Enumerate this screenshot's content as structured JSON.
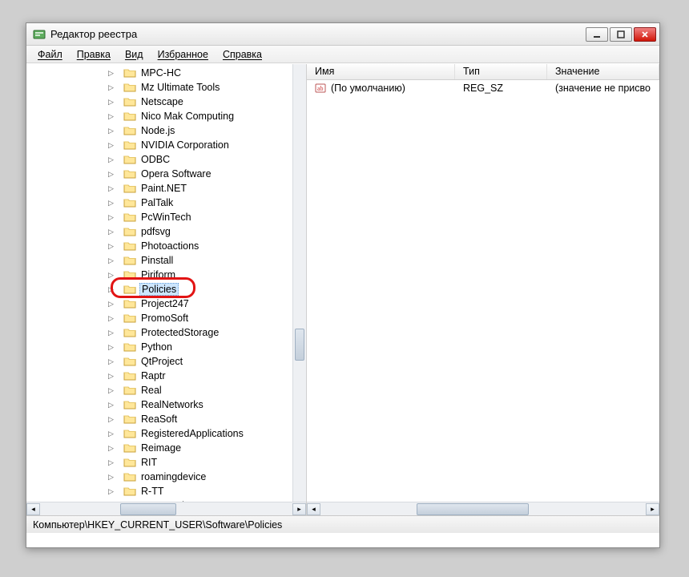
{
  "window": {
    "title": "Редактор реестра"
  },
  "menu": {
    "file": "Файл",
    "edit": "Правка",
    "view": "Вид",
    "favorites": "Избранное",
    "help": "Справка"
  },
  "tree": {
    "items": [
      {
        "label": "MPC-HC",
        "exp": true
      },
      {
        "label": "Mz Ultimate Tools",
        "exp": true
      },
      {
        "label": "Netscape",
        "exp": true
      },
      {
        "label": "Nico Mak Computing",
        "exp": true
      },
      {
        "label": "Node.js",
        "exp": true
      },
      {
        "label": "NVIDIA Corporation",
        "exp": true
      },
      {
        "label": "ODBC",
        "exp": true
      },
      {
        "label": "Opera Software",
        "exp": true
      },
      {
        "label": "Paint.NET",
        "exp": true
      },
      {
        "label": "PalTalk",
        "exp": true
      },
      {
        "label": "PcWinTech",
        "exp": true
      },
      {
        "label": "pdfsvg",
        "exp": true
      },
      {
        "label": "Photoactions",
        "exp": true
      },
      {
        "label": "Pinstall",
        "exp": true
      },
      {
        "label": "Piriform",
        "exp": true
      },
      {
        "label": "Policies",
        "exp": true,
        "selected": true,
        "highlight": true
      },
      {
        "label": "Project247",
        "exp": true
      },
      {
        "label": "PromoSoft",
        "exp": true
      },
      {
        "label": "ProtectedStorage",
        "exp": true
      },
      {
        "label": "Python",
        "exp": true
      },
      {
        "label": "QtProject",
        "exp": true
      },
      {
        "label": "Raptr",
        "exp": true
      },
      {
        "label": "Real",
        "exp": true
      },
      {
        "label": "RealNetworks",
        "exp": true
      },
      {
        "label": "ReaSoft",
        "exp": true
      },
      {
        "label": "RegisteredApplications",
        "exp": true
      },
      {
        "label": "Reimage",
        "exp": true
      },
      {
        "label": "RIT",
        "exp": true
      },
      {
        "label": "roamingdevice",
        "exp": true
      },
      {
        "label": "R-TT",
        "exp": true
      },
      {
        "label": "ScanWorks",
        "exp": true
      }
    ]
  },
  "list": {
    "columns": {
      "name": "Имя",
      "type": "Тип",
      "value": "Значение"
    },
    "rows": [
      {
        "name": "(По умолчанию)",
        "type": "REG_SZ",
        "value": "(значение не присво"
      }
    ]
  },
  "status": {
    "path": "Компьютер\\HKEY_CURRENT_USER\\Software\\Policies"
  }
}
